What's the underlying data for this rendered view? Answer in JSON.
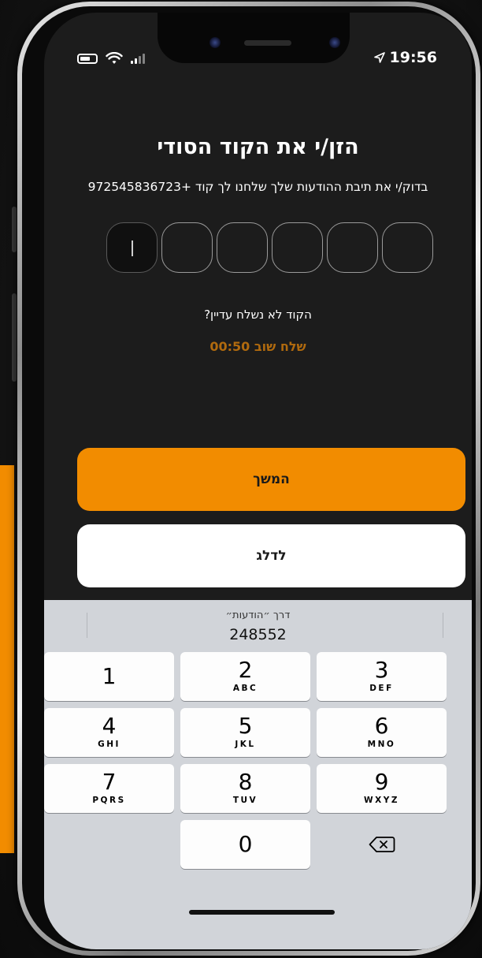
{
  "status_bar": {
    "time": "19:56"
  },
  "header": {
    "title": "הזן/י את הקוד הסודי",
    "subtitle": "בדוק/י את תיבת ההודעות שלך שלחנו לך קוד +972545836723"
  },
  "otp": {
    "length": 6,
    "values": [
      "",
      "",
      "",
      "",
      "",
      ""
    ]
  },
  "resend": {
    "question": "הקוד לא נשלח עדיין?",
    "label": "שלח שוב 00:50"
  },
  "buttons": {
    "continue": "המשך",
    "skip": "לדלג"
  },
  "keyboard": {
    "suggestion_label": "דרך ״הודעות״",
    "suggestion_code": "248552",
    "keys": [
      {
        "num": "1",
        "letters": ""
      },
      {
        "num": "2",
        "letters": "ABC"
      },
      {
        "num": "3",
        "letters": "DEF"
      },
      {
        "num": "4",
        "letters": "GHI"
      },
      {
        "num": "5",
        "letters": "JKL"
      },
      {
        "num": "6",
        "letters": "MNO"
      },
      {
        "num": "7",
        "letters": "PQRS"
      },
      {
        "num": "8",
        "letters": "TUV"
      },
      {
        "num": "9",
        "letters": "WXYZ"
      },
      {
        "num": "0",
        "letters": ""
      }
    ]
  },
  "colors": {
    "accent": "#f28c00",
    "background": "#1c1c1c",
    "resend_text": "#b06a0e",
    "keyboard_bg": "#d1d4d9"
  }
}
